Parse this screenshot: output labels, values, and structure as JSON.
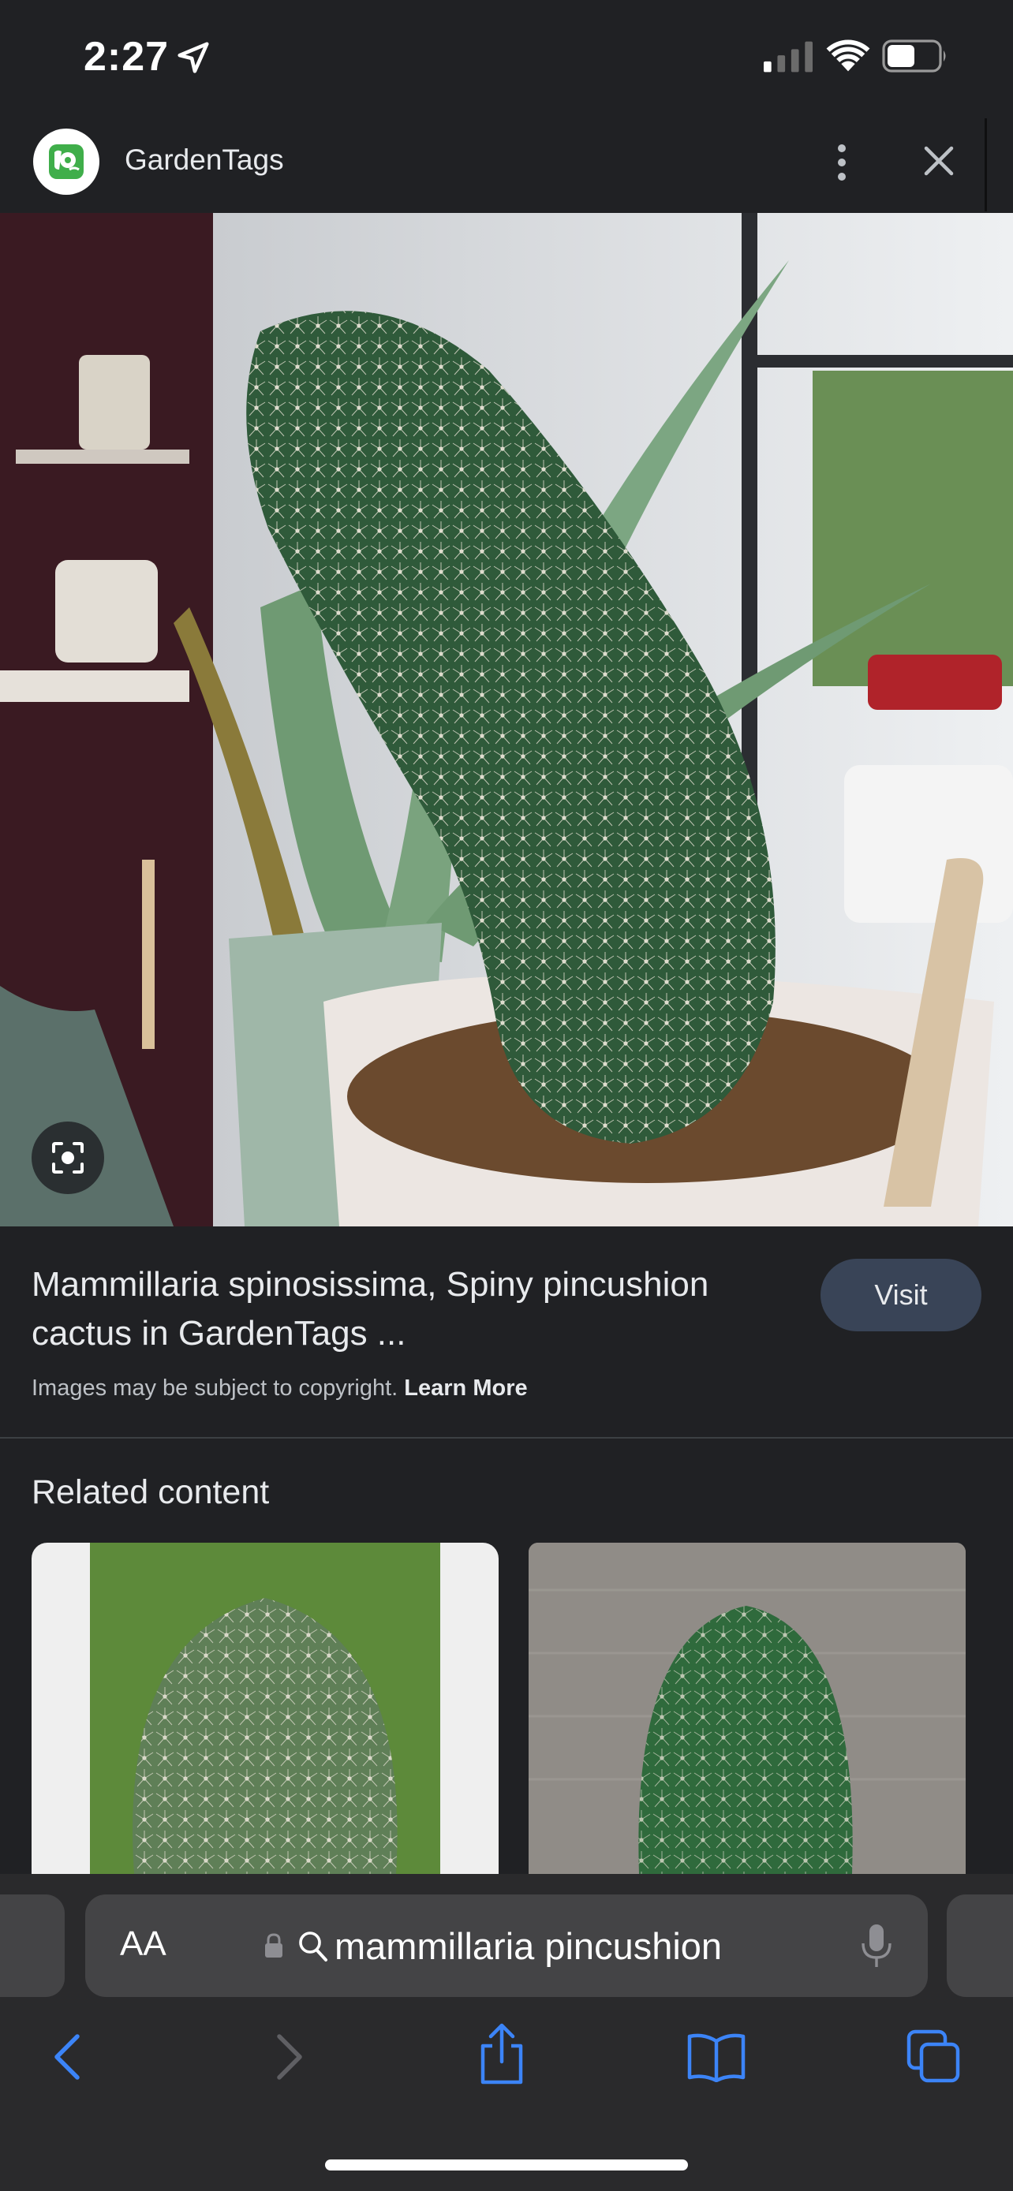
{
  "status_bar": {
    "time": "2:27",
    "icons": [
      "location-arrow-icon",
      "cellular-signal-icon",
      "wifi-icon",
      "battery-icon"
    ]
  },
  "header": {
    "site_name": "GardenTags",
    "logo_icon": "gardentags-logo-icon",
    "menu_icon": "more-vertical-icon",
    "close_icon": "close-icon"
  },
  "result": {
    "title": "Mammillaria spinosissima, Spiny pincushion cactus in GardenTags ...",
    "visit_label": "Visit",
    "copyright_text": "Images may be subject to copyright.",
    "learn_more_label": "Learn More",
    "lens_icon": "lens-search-icon"
  },
  "related": {
    "heading": "Related content"
  },
  "browser": {
    "aa_label": "AA",
    "address_text": "mammillaria pincushion",
    "nav_icons": [
      "back-icon",
      "forward-icon",
      "share-icon",
      "bookmarks-icon",
      "tabs-icon"
    ]
  },
  "colors": {
    "background": "#202124",
    "visit_button": "#394457",
    "toolbar": "#2a2a2c",
    "address_bar": "#444446",
    "safari_blue": "#3c84f7"
  }
}
